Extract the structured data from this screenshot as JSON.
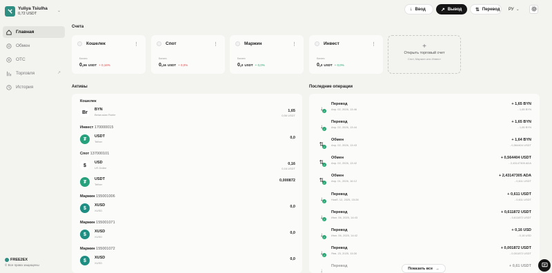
{
  "account": {
    "name": "Yuliya Tsiulha",
    "balance": "0,72 USDT"
  },
  "nav": [
    {
      "label": "Главная",
      "icon": "home-icon",
      "active": true
    },
    {
      "label": "Обмен",
      "icon": "exchange-icon"
    },
    {
      "label": "OTC",
      "icon": "otc-icon"
    },
    {
      "label": "Торговля",
      "icon": "trading-icon"
    },
    {
      "label": "История",
      "icon": "history-icon"
    }
  ],
  "brand": {
    "name": "FREE2EX",
    "copyright": "© Все права защищены"
  },
  "topbar": {
    "deposit": "Ввод",
    "withdraw": "Вывод",
    "transfer": "Перевод",
    "lang": "РУ"
  },
  "accounts_title": "Счета",
  "accounts": [
    {
      "name": "Кошелек",
      "balance_label": "Баланс",
      "int": "0,",
      "dec": "56",
      "currency": "USDT",
      "change": "+ 0,16%",
      "change_color": "#e04848"
    },
    {
      "name": "Спот",
      "balance_label": "Баланс",
      "int": "0,",
      "dec": "16",
      "currency": "USDT",
      "change": "+ 0,0%",
      "change_color": "#e04848"
    },
    {
      "name": "Маржин",
      "balance_label": "Баланс",
      "int": "0,",
      "dec": "0",
      "currency": "USDT",
      "change": "+ 0,0%",
      "change_color": "#2aa672"
    },
    {
      "name": "Инвест",
      "balance_label": "Баланс",
      "int": "0,",
      "dec": "0",
      "currency": "USDT",
      "change": "+ 0,0%",
      "change_color": "#2aa672"
    }
  ],
  "open_account": {
    "title": "Открыть торговый счет",
    "subtitle": "Спот, Маржин или Инвест"
  },
  "assets_title": "Активы",
  "asset_groups": [
    {
      "label": "Кошелек",
      "number": ""
    },
    {
      "label": "Инвест",
      "number": "170000015"
    },
    {
      "label": "Спот",
      "number": "137000101"
    },
    {
      "label": "Маржин",
      "number": "155001006"
    },
    {
      "label": "Маржин",
      "number": "155001071"
    },
    {
      "label": "Маржин",
      "number": "155001072"
    }
  ],
  "assets": [
    {
      "symbol": "BYN",
      "name": "Belarusian Ruble",
      "value": "1,65",
      "usdt": "0,56 USDT",
      "icon": "Br",
      "icon_name": "byn-icon",
      "bg": "#ffffff",
      "fg": "#111"
    },
    {
      "symbol": "USDT",
      "name": "Tether",
      "value": "0,0",
      "usdt": "",
      "icon": "₮",
      "icon_name": "tether-icon",
      "bg": "#26a17b",
      "fg": "#fff"
    },
    {
      "symbol": "USD",
      "name": "US Dollar",
      "value": "0,16",
      "usdt": "0,16 USDT",
      "icon": "$",
      "icon_name": "usd-icon",
      "bg": "#ffffff",
      "fg": "#111"
    },
    {
      "symbol": "USDT",
      "name": "Tether",
      "value": "0,000872",
      "usdt": "",
      "icon": "₮",
      "icon_name": "tether-icon",
      "bg": "#26a17b",
      "fg": "#fff"
    },
    {
      "symbol": "XUSD",
      "name": "XUSD",
      "value": "0,0",
      "usdt": "",
      "icon": "$",
      "icon_name": "xusd-icon",
      "bg": "#1f8e82",
      "fg": "#fff"
    },
    {
      "symbol": "XUSD",
      "name": "XUSD",
      "value": "0,0",
      "usdt": "",
      "icon": "$",
      "icon_name": "xusd-icon",
      "bg": "#1f8e82",
      "fg": "#fff"
    },
    {
      "symbol": "XUSD",
      "name": "XUSD",
      "value": "0,0",
      "usdt": "",
      "icon": "$",
      "icon_name": "xusd-icon",
      "bg": "#1f8e82",
      "fg": "#fff"
    }
  ],
  "ops_title": "Последние операции",
  "operations": [
    {
      "type": "Перевод",
      "date": "Апр. 02, 2026, 13:46",
      "amount": "+ 1,65 BYN",
      "sub": "- 1,65 BYN",
      "icon": "↓",
      "icon_name": "transfer-in-icon"
    },
    {
      "type": "Перевод",
      "date": "Апр. 02, 2026, 13:44",
      "amount": "+ 1,65 BYN",
      "sub": "- 1,65 BYN",
      "icon": "↓",
      "icon_name": "transfer-in-icon"
    },
    {
      "type": "Обмен",
      "date": "Апр. 02, 2026, 13:43",
      "amount": "+ 1,64 BYN",
      "sub": "- 0,564404 USDT",
      "icon": "⇅",
      "icon_name": "exchange-icon"
    },
    {
      "type": "Обмен",
      "date": "Апр. 02, 2026, 13:42",
      "amount": "+ 0,564404 USDT",
      "sub": "- 2,43147305 ADA",
      "icon": "⇅",
      "icon_name": "exchange-icon"
    },
    {
      "type": "Обмен",
      "date": "Апр. 01, 2026, 16:12",
      "amount": "+ 2,43147305 ADA",
      "sub": "- 0,611 USDT",
      "icon": "⇅",
      "icon_name": "exchange-icon"
    },
    {
      "type": "Перевод",
      "date": "Нояб. 12, 2025, 15:28",
      "amount": "+ 0,611 USDT",
      "sub": "- 0,611 USDT",
      "icon": "↓",
      "icon_name": "transfer-in-icon"
    },
    {
      "type": "Перевод",
      "date": "Июн. 06, 2025, 14:43",
      "amount": "+ 0,611872 USDT",
      "sub": "- 0,611872 USDT",
      "icon": "↓",
      "icon_name": "transfer-in-icon"
    },
    {
      "type": "Перевод",
      "date": "Июн. 06, 2025, 14:42",
      "amount": "+ 0,16 USD",
      "sub": "- 0,16 USD",
      "icon": "↓",
      "icon_name": "transfer-in-icon"
    },
    {
      "type": "Перевод",
      "date": "Янв. 23, 2025, 15:30",
      "amount": "+ 0,001872 USDT",
      "sub": "- 0,001872 USDT",
      "icon": "↓",
      "icon_name": "transfer-in-icon"
    },
    {
      "type": "Перевод",
      "date": "",
      "amount": "+ 0,61 USDT",
      "sub": "",
      "icon": "↓",
      "icon_name": "transfer-in-icon"
    }
  ],
  "show_all": "Показать все"
}
